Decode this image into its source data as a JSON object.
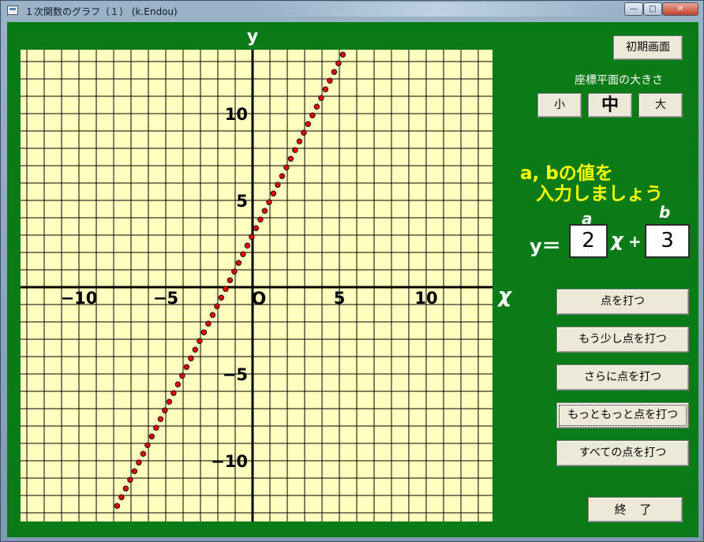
{
  "window": {
    "title": "１次関数のグラフ（１） (k.Endou)"
  },
  "graph": {
    "y_axis_label": "y",
    "x_axis_label": "χ",
    "origin_label": "O",
    "xlim": [
      -13,
      13.8
    ],
    "ylim": [
      -13.5,
      13.7
    ],
    "x_tick_labels": [
      {
        "value": -10,
        "text": "−10"
      },
      {
        "value": -5,
        "text": "−5"
      },
      {
        "value": 5,
        "text": "5"
      },
      {
        "value": 10,
        "text": "10"
      }
    ],
    "y_tick_labels": [
      {
        "value": 10,
        "text": "10"
      },
      {
        "value": 5,
        "text": "5"
      },
      {
        "value": -5,
        "text": "−5"
      },
      {
        "value": -10,
        "text": "−10"
      }
    ],
    "colors": {
      "background": "#ffffc0",
      "grid": "#000000",
      "points": "#e00000",
      "frame": "#0b7b17"
    }
  },
  "chart_data": {
    "type": "scatter",
    "equation": {
      "a": 2,
      "b": 3
    },
    "x_start": -7.8,
    "x_end": 5.4,
    "x_step": 0.25,
    "grid": true,
    "xlim": [
      -13,
      13.8
    ],
    "ylim": [
      -13.5,
      13.7
    ]
  },
  "controls": {
    "reset_label": "初期画面",
    "size_caption": "座標平面の大きさ",
    "size_small": "小",
    "size_medium": "中",
    "size_large": "大",
    "prompt_line1": "a, bの値を",
    "prompt_line2": "入力しましょう",
    "label_a": "a",
    "label_b": "b",
    "eq_y": "y＝",
    "eq_x": "χ",
    "eq_plus": "+",
    "a_value": "2",
    "b_value": "3",
    "plot": "点を打つ",
    "plot_more": "もう少し点を打つ",
    "plot_further": "さらに点を打つ",
    "plot_even_more": "もっともっと点を打つ",
    "plot_all": "すべての点を打つ",
    "exit": "終 了"
  }
}
